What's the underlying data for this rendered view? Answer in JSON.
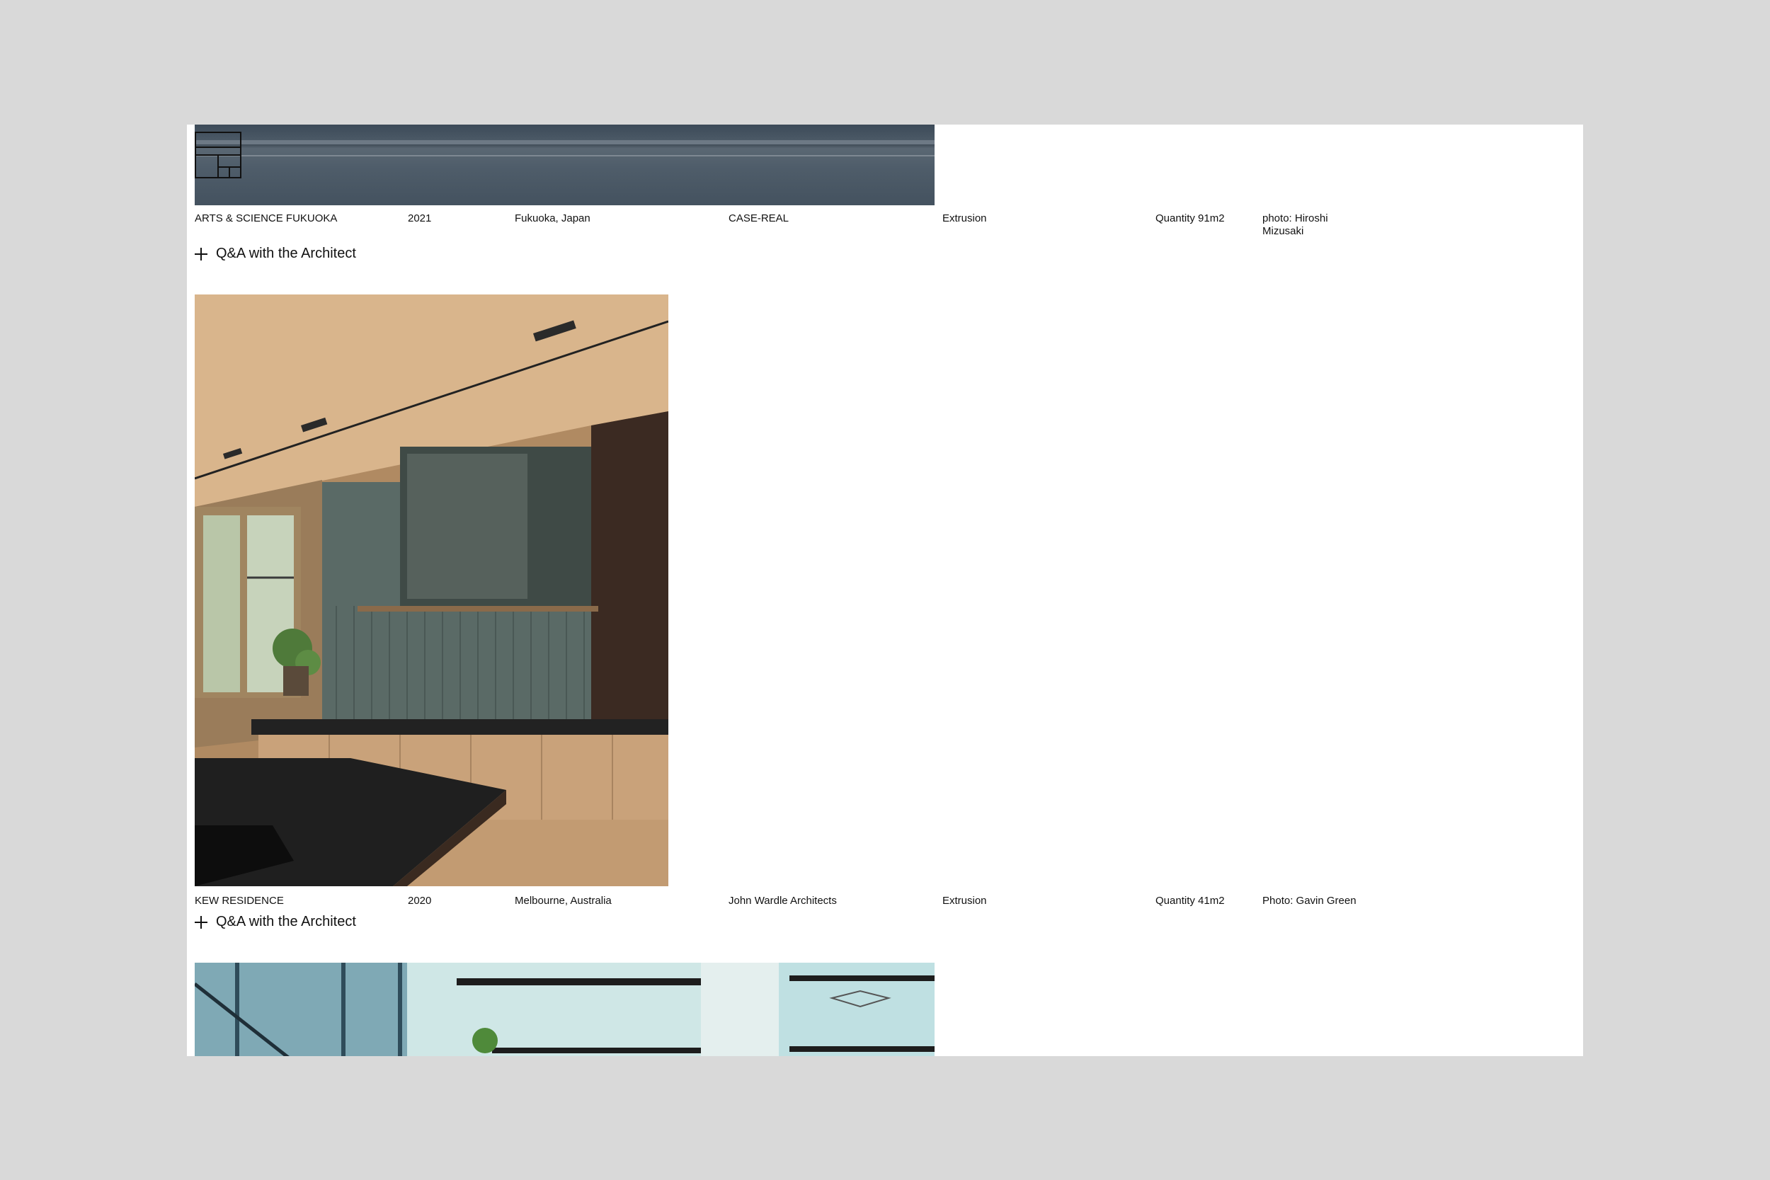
{
  "projects": [
    {
      "name": "ARTS & SCIENCE FUKUOKA",
      "year": "2021",
      "location": "Fukuoka, Japan",
      "architect": "CASE-REAL",
      "product": "Extrusion",
      "quantity": "Quantity 91m2",
      "photo": "photo: Hiroshi Mizusaki",
      "qa_label": "Q&A with the Architect"
    },
    {
      "name": "KEW RESIDENCE",
      "year": "2020",
      "location": "Melbourne, Australia",
      "architect": "John Wardle Architects",
      "product": "Extrusion",
      "quantity": "Quantity 41m2",
      "photo": "Photo: Gavin Green",
      "qa_label": "Q&A with the Architect"
    }
  ],
  "icons": {
    "logo": "grid-square-logo-icon",
    "expand": "plus-icon"
  },
  "colors": {
    "backdrop": "#d9d9d9",
    "page": "#ffffff",
    "text": "#111111"
  }
}
